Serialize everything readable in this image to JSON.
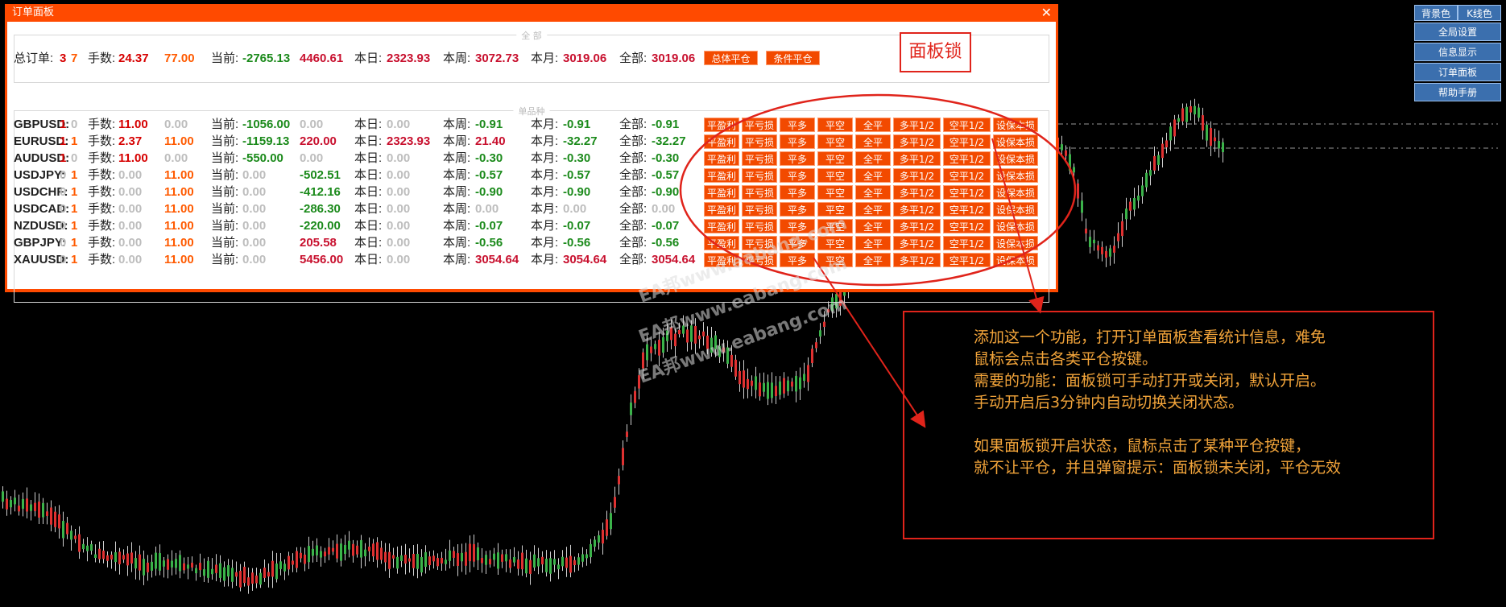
{
  "chart_bg": {
    "line_color": "#9a9a9a",
    "bull_color": "#3bb34a",
    "bear_color": "#e03131",
    "wick_color": "#cfcfcf"
  },
  "top_buttons": {
    "bg_color": "背景色",
    "k_color": "K线色",
    "global_settings": "全局设置",
    "info_display": "信息显示",
    "order_panel": "订单面板",
    "help": "帮助手册"
  },
  "panel": {
    "title": "订单面板",
    "close": "✕",
    "section_all": "全 部",
    "section_symbol": "单品种",
    "summary": {
      "total_label": "总订单:",
      "count_a": "3",
      "count_b": "7",
      "lots_label": "手数:",
      "lots_a": "24.37",
      "lots_b": "77.00",
      "current_label": "当前:",
      "current_a": "-2765.13",
      "current_b": "4460.61",
      "day_label": "本日:",
      "day": "2323.93",
      "week_label": "本周:",
      "week": "3072.73",
      "month_label": "本月:",
      "month": "3019.06",
      "all_label": "全部:",
      "all": "3019.06",
      "btn_close_all": "总体平仓",
      "btn_cond_close": "条件平仓"
    },
    "labels": {
      "lots": "手数:",
      "current": "当前:",
      "day": "本日:",
      "week": "本周:",
      "month": "本月:",
      "all": "全部:"
    },
    "actions": [
      "平盈利",
      "平亏损",
      "平多",
      "平空",
      "全平",
      "多平1/2",
      "空平1/2",
      "设保本损"
    ],
    "rows": [
      {
        "symbol": "GBPUSD:",
        "n1": "1",
        "n2": "0",
        "lots1": "11.00",
        "lots2": "0.00",
        "cur1": "-1056.00",
        "cur2": "0.00",
        "day": "0.00",
        "week": "-0.91",
        "month": "-0.91",
        "all": "-0.91"
      },
      {
        "symbol": "EURUSD:",
        "n1": "1",
        "n2": "1",
        "lots1": "2.37",
        "lots2": "11.00",
        "cur1": "-1159.13",
        "cur2": "220.00",
        "day": "2323.93",
        "week": "21.40",
        "month": "-32.27",
        "all": "-32.27"
      },
      {
        "symbol": "AUDUSD:",
        "n1": "1",
        "n2": "0",
        "lots1": "11.00",
        "lots2": "0.00",
        "cur1": "-550.00",
        "cur2": "0.00",
        "day": "0.00",
        "week": "-0.30",
        "month": "-0.30",
        "all": "-0.30"
      },
      {
        "symbol": "USDJPY:",
        "n1": "0",
        "n2": "1",
        "lots1": "0.00",
        "lots2": "11.00",
        "cur1": "0.00",
        "cur2": "-502.51",
        "day": "0.00",
        "week": "-0.57",
        "month": "-0.57",
        "all": "-0.57"
      },
      {
        "symbol": "USDCHF:",
        "n1": "0",
        "n2": "1",
        "lots1": "0.00",
        "lots2": "11.00",
        "cur1": "0.00",
        "cur2": "-412.16",
        "day": "0.00",
        "week": "-0.90",
        "month": "-0.90",
        "all": "-0.90"
      },
      {
        "symbol": "USDCAD:",
        "n1": "0",
        "n2": "1",
        "lots1": "0.00",
        "lots2": "11.00",
        "cur1": "0.00",
        "cur2": "-286.30",
        "day": "0.00",
        "week": "0.00",
        "month": "0.00",
        "all": "0.00"
      },
      {
        "symbol": "NZDUSD:",
        "n1": "0",
        "n2": "1",
        "lots1": "0.00",
        "lots2": "11.00",
        "cur1": "0.00",
        "cur2": "-220.00",
        "day": "0.00",
        "week": "-0.07",
        "month": "-0.07",
        "all": "-0.07"
      },
      {
        "symbol": "GBPJPY:",
        "n1": "0",
        "n2": "1",
        "lots1": "0.00",
        "lots2": "11.00",
        "cur1": "0.00",
        "cur2": "205.58",
        "day": "0.00",
        "week": "-0.56",
        "month": "-0.56",
        "all": "-0.56"
      },
      {
        "symbol": "XAUUSD:",
        "n1": "0",
        "n2": "1",
        "lots1": "0.00",
        "lots2": "11.00",
        "cur1": "0.00",
        "cur2": "5456.00",
        "day": "0.00",
        "week": "3054.64",
        "month": "3054.64",
        "all": "3054.64"
      }
    ]
  },
  "annotation": {
    "lock_label": "面板锁",
    "lines": [
      "添加这一个功能，打开订单面板查看统计信息，难免",
      "鼠标会点击各类平仓按键。",
      "需要的功能：面板锁可手动打开或关闭，默认开启。",
      "手动开启后3分钟内自动切换关闭状态。",
      "",
      "如果面板锁开启状态，鼠标点击了某种平仓按键，",
      "就不让平仓，并且弹窗提示：面板锁未关闭，平仓无效"
    ],
    "color": "#e0241b"
  },
  "watermark": "EA邦www.eabang.com"
}
